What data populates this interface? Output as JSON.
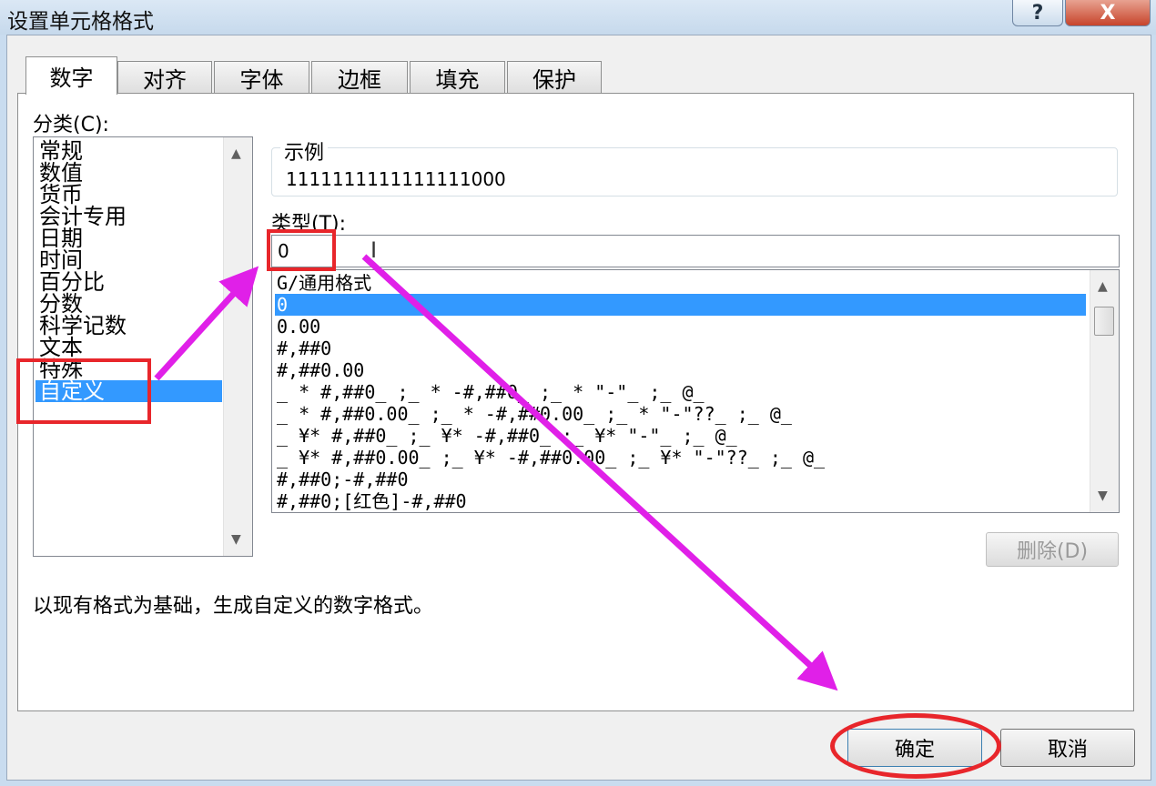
{
  "window": {
    "title": "设置单元格格式",
    "help_label": "?",
    "close_label": "X"
  },
  "tabs": [
    {
      "label": "数字",
      "active": true
    },
    {
      "label": "对齐",
      "active": false
    },
    {
      "label": "字体",
      "active": false
    },
    {
      "label": "边框",
      "active": false
    },
    {
      "label": "填充",
      "active": false
    },
    {
      "label": "保护",
      "active": false
    }
  ],
  "category": {
    "label": "分类(C):",
    "items": [
      "常规",
      "数值",
      "货币",
      "会计专用",
      "日期",
      "时间",
      "百分比",
      "分数",
      "科学记数",
      "文本",
      "特殊",
      "自定义"
    ],
    "selected": "自定义"
  },
  "sample": {
    "label": "示例",
    "value": "1111111111111111000"
  },
  "type_field": {
    "label": "类型(T):",
    "value": "0"
  },
  "format_list": {
    "items": [
      "G/通用格式",
      "0",
      "0.00",
      "#,##0",
      "#,##0.00",
      "_ * #,##0_ ;_ * -#,##0_ ;_ * \"-\"_ ;_ @_",
      "_ * #,##0.00_ ;_ * -#,##0.00_ ;_ * \"-\"??_ ;_ @_",
      "_ ¥* #,##0_ ;_ ¥* -#,##0_ ;_ ¥* \"-\"_ ;_ @_",
      "_ ¥* #,##0.00_ ;_ ¥* -#,##0.00_ ;_ ¥* \"-\"??_ ;_ @_",
      "#,##0;-#,##0",
      "#,##0;[红色]-#,##0"
    ],
    "selected": "0"
  },
  "delete_button": "删除(D)",
  "description": "以现有格式为基础，生成自定义的数字格式。",
  "ok_button": "确定",
  "cancel_button": "取消",
  "colors": {
    "selection": "#3399ff",
    "annotation_red": "#e8262b",
    "annotation_arrow": "#e020e8"
  }
}
